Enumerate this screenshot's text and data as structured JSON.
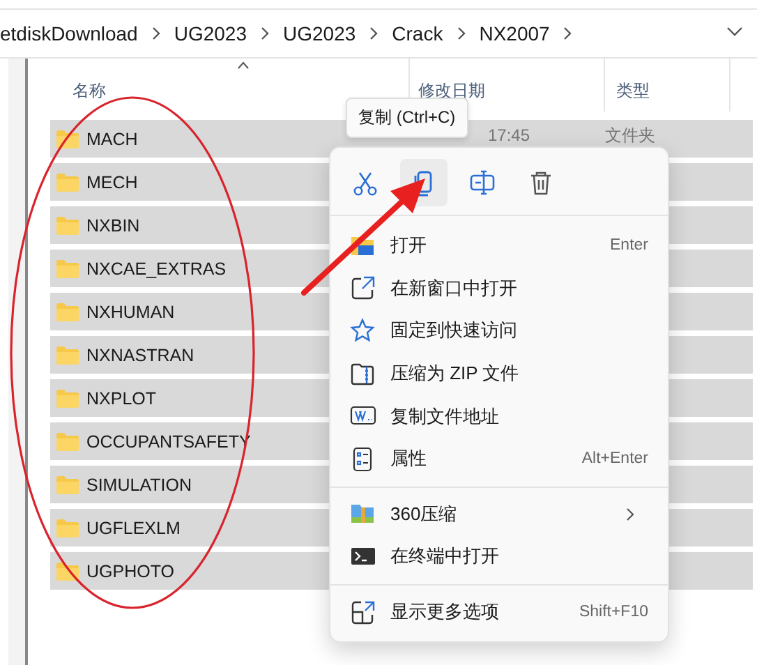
{
  "breadcrumb": [
    "etdiskDownload",
    "UG2023",
    "UG2023",
    "Crack",
    "NX2007"
  ],
  "columns": [
    {
      "label": "名称",
      "sorted": true
    },
    {
      "label": "修改日期"
    },
    {
      "label": "类型"
    }
  ],
  "rows": [
    {
      "name": "MACH",
      "date": "17:45",
      "type": "文件夹",
      "selected": true
    },
    {
      "name": "MECH",
      "selected": true
    },
    {
      "name": "NXBIN",
      "selected": true
    },
    {
      "name": "NXCAE_EXTRAS",
      "selected": true
    },
    {
      "name": "NXHUMAN",
      "selected": true
    },
    {
      "name": "NXNASTRAN",
      "selected": true
    },
    {
      "name": "NXPLOT",
      "selected": true
    },
    {
      "name": "OCCUPANTSAFETY",
      "selected": true
    },
    {
      "name": "SIMULATION",
      "selected": true
    },
    {
      "name": "UGFLEXLM",
      "selected": true
    },
    {
      "name": "UGPHOTO",
      "selected": true
    }
  ],
  "context_menu": {
    "tooltip": "复制 (Ctrl+C)",
    "toolbar": [
      {
        "kind": "cut",
        "selected": false
      },
      {
        "kind": "copy",
        "selected": true
      },
      {
        "kind": "rename",
        "selected": false
      },
      {
        "kind": "delete",
        "selected": false
      }
    ],
    "items": [
      {
        "kind": "open",
        "label": "打开",
        "shortcut": "Enter"
      },
      {
        "kind": "newwindow",
        "label": "在新窗口中打开"
      },
      {
        "kind": "pin",
        "label": "固定到快速访问"
      },
      {
        "kind": "zip",
        "label": "压缩为 ZIP 文件"
      },
      {
        "kind": "path",
        "label": "复制文件地址"
      },
      {
        "kind": "props",
        "label": "属性",
        "shortcut": "Alt+Enter"
      },
      {
        "kind": "separator"
      },
      {
        "kind": "archive",
        "label": "360压缩",
        "submenu": true
      },
      {
        "kind": "terminal",
        "label": "在终端中打开"
      },
      {
        "kind": "separator"
      },
      {
        "kind": "more",
        "label": "显示更多选项",
        "shortcut": "Shift+F10"
      }
    ]
  }
}
